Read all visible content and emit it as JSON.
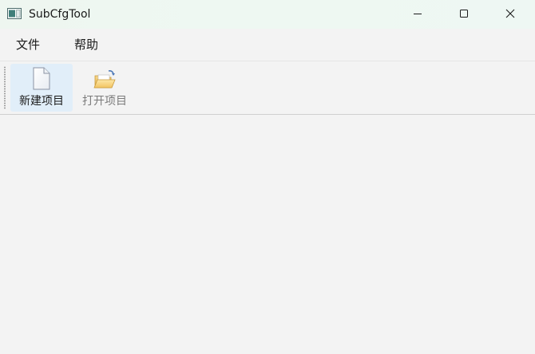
{
  "window": {
    "title": "SubCfgTool",
    "app_icon": "app-window-icon",
    "controls": {
      "minimize_icon": "minimize-icon",
      "maximize_icon": "maximize-icon",
      "close_icon": "close-icon"
    }
  },
  "menubar": {
    "items": [
      {
        "label": "文件"
      },
      {
        "label": "帮助"
      }
    ]
  },
  "toolbar": {
    "buttons": [
      {
        "label": "新建项目",
        "icon": "new-document-icon",
        "state": "hover"
      },
      {
        "label": "打开项目",
        "icon": "open-folder-icon",
        "state": "disabled"
      }
    ]
  },
  "colors": {
    "background": "#f3f3f3",
    "titlebar_tint": "#eef7f2",
    "hover_highlight": "#e1eef9",
    "disabled_text": "#7a7a7a"
  }
}
